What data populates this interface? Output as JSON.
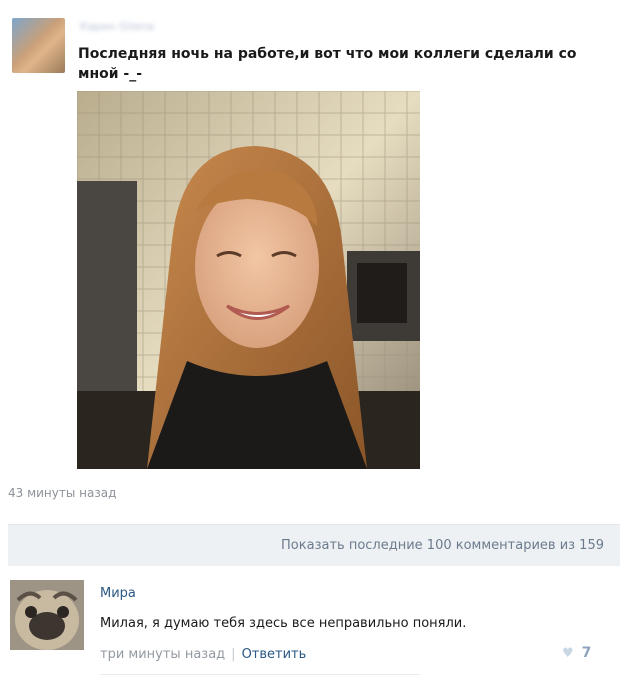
{
  "post": {
    "author": "Карен Gilena",
    "text": "Последняя ночь на работе,и вот что мои коллеги сделали со мной -_-",
    "time": "43 минуты назад"
  },
  "comments_bar": {
    "label": "Показать последние 100 комментариев из 159"
  },
  "comment": {
    "name": "Мира",
    "text": "Милая, я думаю тебя здесь все неправильно поняли.",
    "time": "три минуты назад",
    "reply_label": "Ответить",
    "likes": "7",
    "like_icon": "heart-icon"
  }
}
